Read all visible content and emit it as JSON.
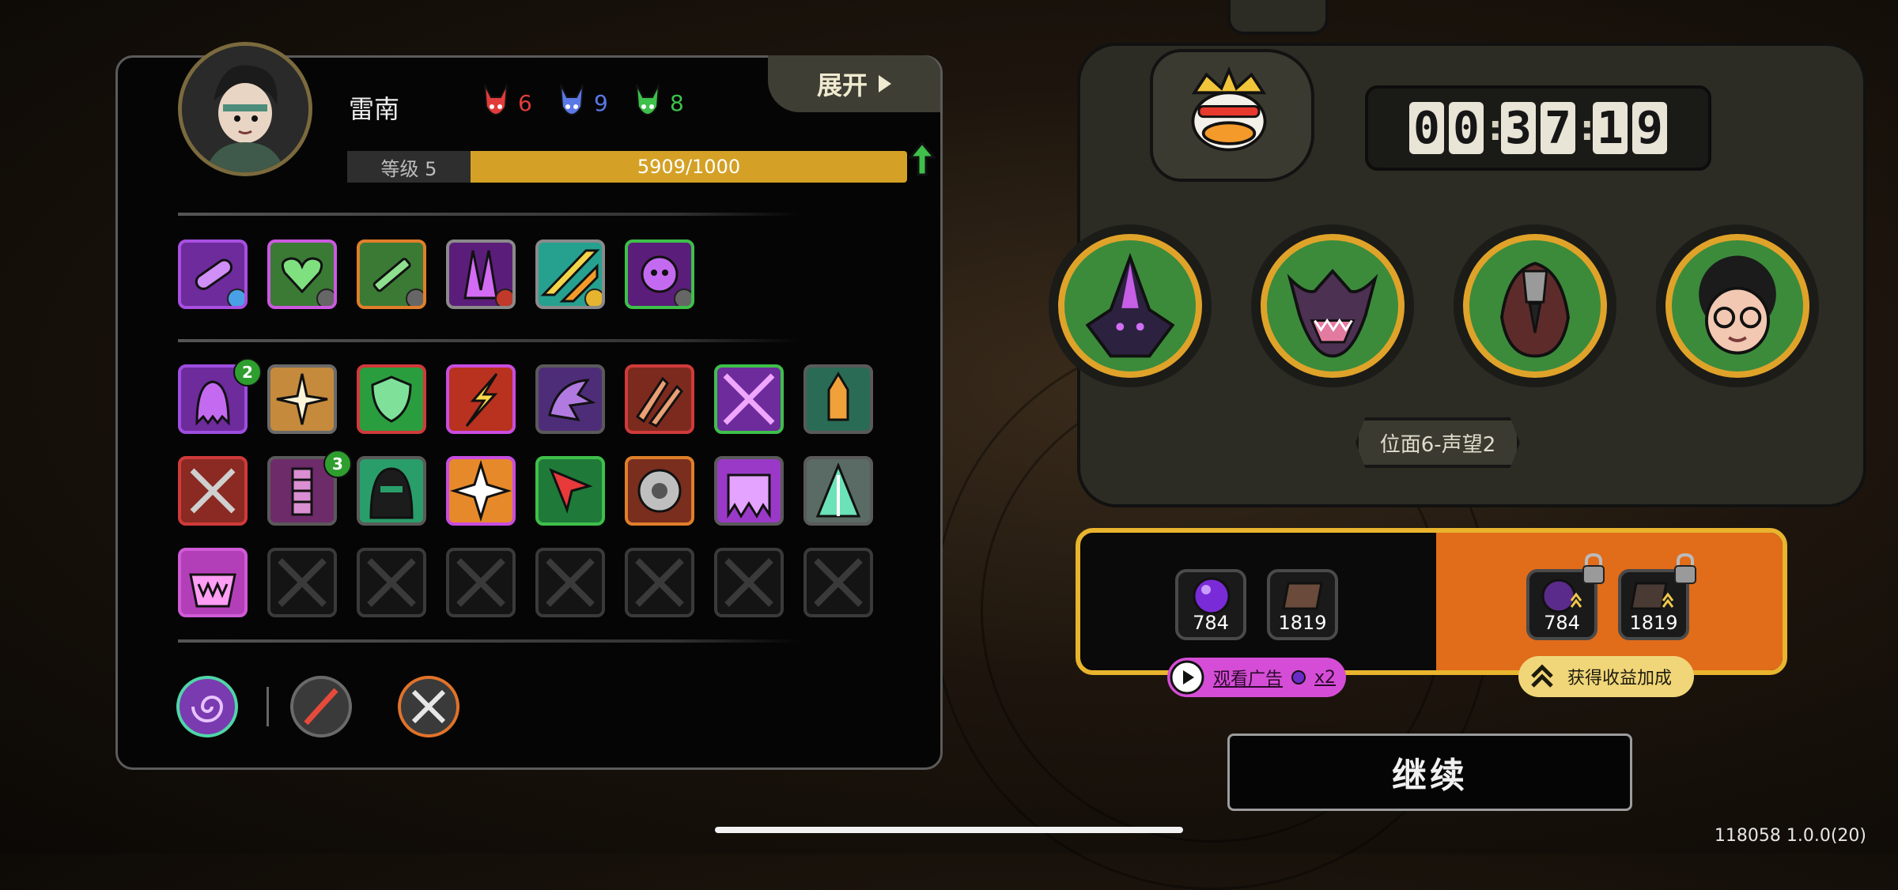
{
  "profile": {
    "name": "雷南",
    "expand_label": "展开",
    "level_label": "等级 5",
    "xp_text": "5909/1000",
    "xp_progress": 1.0,
    "resources": [
      {
        "icon": "red-horned-mask-icon",
        "value": "6",
        "color": "#e23b3b"
      },
      {
        "icon": "blue-horned-mask-icon",
        "value": "9",
        "color": "#5a78e6"
      },
      {
        "icon": "green-horned-mask-icon",
        "value": "8",
        "color": "#3ec04a"
      }
    ]
  },
  "equipment_icons": [
    "purple-vial-icon",
    "green-heart-icon",
    "syringe-icon",
    "purple-claw-icon",
    "lightning-stripes-icon",
    "purple-void-skull-icon"
  ],
  "skill_badges": {
    "row1_col1": "2",
    "row2_col2": "3"
  },
  "skill_icons": [
    "purple-ghost-icon",
    "crack-explosion-icon",
    "green-shield-icon",
    "red-lightning-icon",
    "purple-beast-icon",
    "red-claws-icon",
    "crossed-arrows-icon",
    "bullet-sigil-icon",
    "crossed-swords-icon",
    "purple-coil-icon",
    "hooded-assassin-icon",
    "spark-burst-icon",
    "red-arrow-cursor-icon",
    "rune-disc-icon",
    "purple-slime-icon",
    "cloaked-spear-icon",
    "pink-demon-maw-icon"
  ],
  "bottom_abilities": [
    "spiral-vortex-icon",
    "red-slash-icon",
    "crossed-blades-icon"
  ],
  "timer": {
    "digits": [
      "0",
      "0",
      "3",
      "7",
      "1",
      "9"
    ]
  },
  "emblem": "crowned-duck-emblem-icon",
  "party": [
    "purple-wraith-portrait",
    "horned-demon-portrait",
    "hooded-bird-portrait",
    "curly-hair-glasses-portrait"
  ],
  "stage_label": "位面6-声望2",
  "rewards": {
    "free": [
      {
        "icon": "purple-orb-icon",
        "count": "784"
      },
      {
        "icon": "brown-tome-icon",
        "count": "1819"
      }
    ],
    "bonus": [
      {
        "icon": "purple-orb-icon",
        "count": "784"
      },
      {
        "icon": "brown-tome-icon",
        "count": "1819"
      }
    ],
    "ad_label": "观看广告",
    "ad_multiplier": "x2",
    "bonus_label": "获得收益加成"
  },
  "continue_label": "继续",
  "version": "118058 1.0.0(20)"
}
